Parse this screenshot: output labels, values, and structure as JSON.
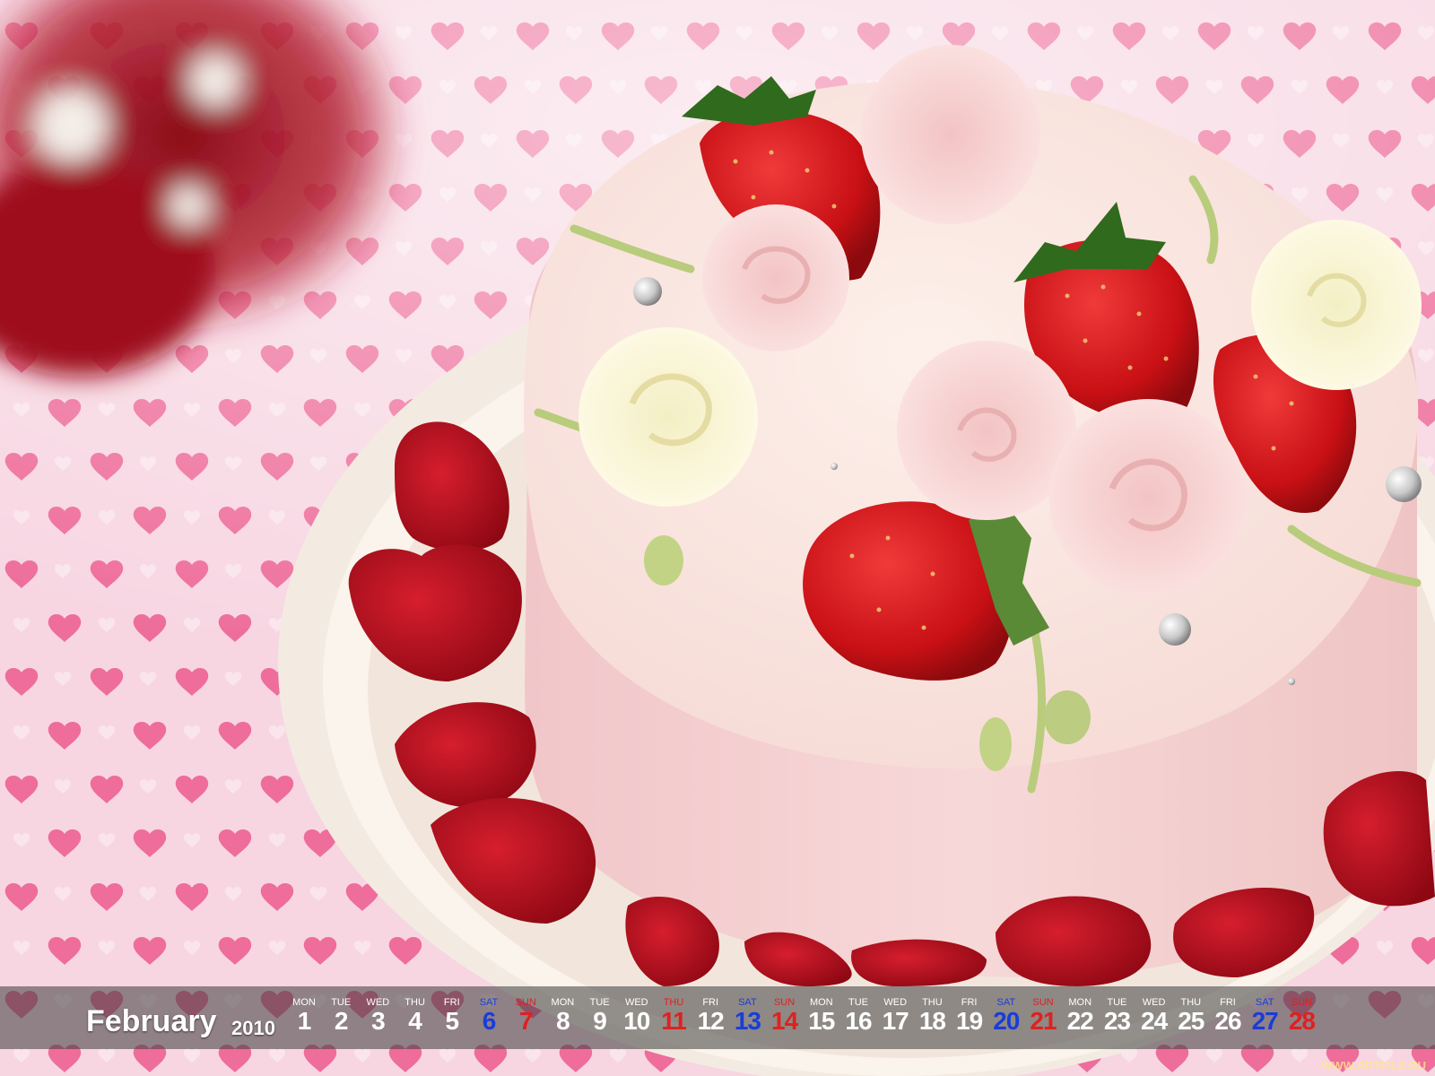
{
  "calendar": {
    "month": "February",
    "year": "2010",
    "colors": {
      "weekday": "#ffffff",
      "saturday": "#1a3dd8",
      "sunday": "#e02020"
    },
    "days": [
      {
        "dow": "MON",
        "num": "1",
        "kind": "weekday"
      },
      {
        "dow": "TUE",
        "num": "2",
        "kind": "weekday"
      },
      {
        "dow": "WED",
        "num": "3",
        "kind": "weekday"
      },
      {
        "dow": "THU",
        "num": "4",
        "kind": "weekday"
      },
      {
        "dow": "FRI",
        "num": "5",
        "kind": "weekday"
      },
      {
        "dow": "SAT",
        "num": "6",
        "kind": "sat"
      },
      {
        "dow": "SUN",
        "num": "7",
        "kind": "sun"
      },
      {
        "dow": "MON",
        "num": "8",
        "kind": "weekday"
      },
      {
        "dow": "TUE",
        "num": "9",
        "kind": "weekday"
      },
      {
        "dow": "WED",
        "num": "10",
        "kind": "weekday"
      },
      {
        "dow": "THU",
        "num": "11",
        "kind": "holiday"
      },
      {
        "dow": "FRI",
        "num": "12",
        "kind": "weekday"
      },
      {
        "dow": "SAT",
        "num": "13",
        "kind": "sat"
      },
      {
        "dow": "SUN",
        "num": "14",
        "kind": "sun"
      },
      {
        "dow": "MON",
        "num": "15",
        "kind": "weekday"
      },
      {
        "dow": "TUE",
        "num": "16",
        "kind": "weekday"
      },
      {
        "dow": "WED",
        "num": "17",
        "kind": "weekday"
      },
      {
        "dow": "THU",
        "num": "18",
        "kind": "weekday"
      },
      {
        "dow": "FRI",
        "num": "19",
        "kind": "weekday"
      },
      {
        "dow": "SAT",
        "num": "20",
        "kind": "sat"
      },
      {
        "dow": "SUN",
        "num": "21",
        "kind": "sun"
      },
      {
        "dow": "MON",
        "num": "22",
        "kind": "weekday"
      },
      {
        "dow": "TUE",
        "num": "23",
        "kind": "weekday"
      },
      {
        "dow": "WED",
        "num": "24",
        "kind": "weekday"
      },
      {
        "dow": "THU",
        "num": "25",
        "kind": "weekday"
      },
      {
        "dow": "FRI",
        "num": "26",
        "kind": "weekday"
      },
      {
        "dow": "SAT",
        "num": "27",
        "kind": "sat"
      },
      {
        "dow": "SUN",
        "num": "28",
        "kind": "sun"
      }
    ]
  },
  "watermark": "WWW.ARTFILE.RU"
}
